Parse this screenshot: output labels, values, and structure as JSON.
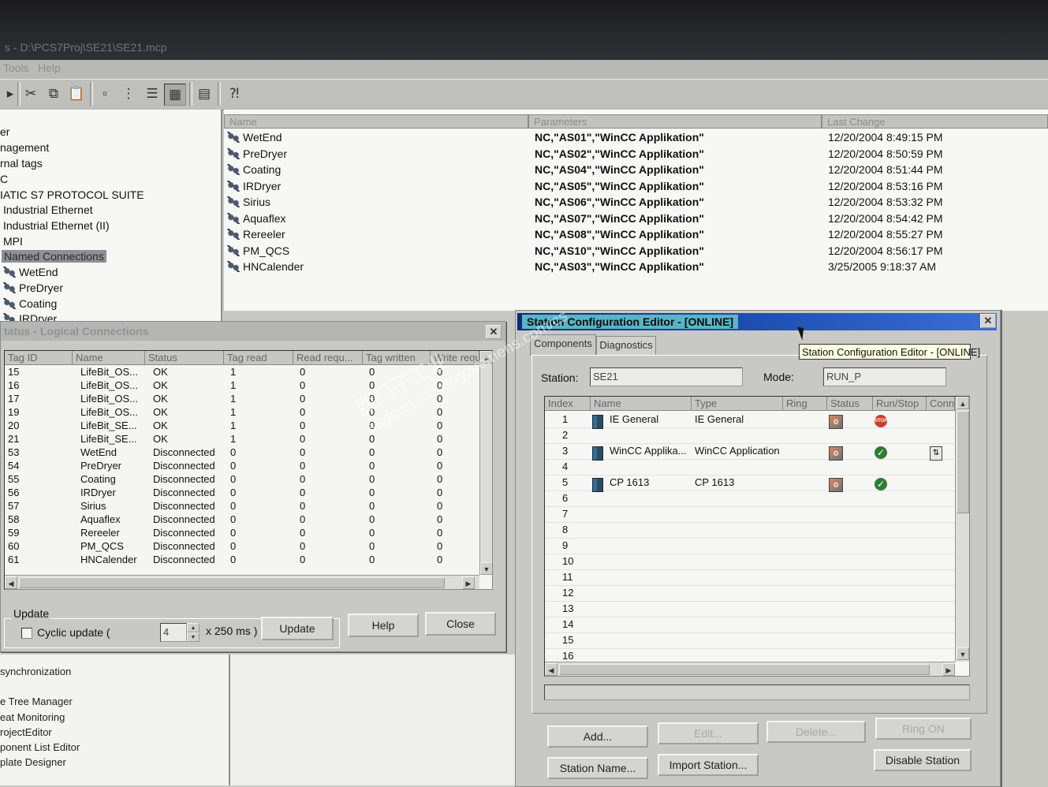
{
  "window": {
    "title": "s - D:\\PCS7Proj\\SE21\\SE21.mcp"
  },
  "menu": [
    "Tools",
    "Help"
  ],
  "toolbar_icons": [
    "back-icon",
    "cut-icon",
    "copy-icon",
    "paste-icon",
    "large-icons-icon",
    "small-icons-icon",
    "list-icon",
    "details-icon",
    "properties-icon",
    "help-icon"
  ],
  "tree": {
    "items": [
      "er",
      "nagement",
      "rnal tags",
      "C",
      "IATIC S7 PROTOCOL SUITE",
      "Industrial Ethernet",
      "Industrial Ethernet (II)",
      "MPI",
      "Named Connections",
      "WetEnd",
      "PreDryer",
      "Coating",
      "IRDryer"
    ],
    "selected": "Named Connections"
  },
  "list": {
    "columns": [
      "Name",
      "Parameters",
      "Last Change"
    ],
    "rows": [
      [
        "WetEnd",
        "NC,\"AS01\",\"WinCC Applikation\"",
        "12/20/2004 8:49:15 PM"
      ],
      [
        "PreDryer",
        "NC,\"AS02\",\"WinCC Applikation\"",
        "12/20/2004 8:50:59 PM"
      ],
      [
        "Coating",
        "NC,\"AS04\",\"WinCC Applikation\"",
        "12/20/2004 8:51:44 PM"
      ],
      [
        "IRDryer",
        "NC,\"AS05\",\"WinCC Applikation\"",
        "12/20/2004 8:53:16 PM"
      ],
      [
        "Sirius",
        "NC,\"AS06\",\"WinCC Applikation\"",
        "12/20/2004 8:53:32 PM"
      ],
      [
        "Aquaflex",
        "NC,\"AS07\",\"WinCC Applikation\"",
        "12/20/2004 8:54:42 PM"
      ],
      [
        "Rereeler",
        "NC,\"AS08\",\"WinCC Applikation\"",
        "12/20/2004 8:55:27 PM"
      ],
      [
        "PM_QCS",
        "NC,\"AS10\",\"WinCC Applikation\"",
        "12/20/2004 8:56:17 PM"
      ],
      [
        "HNCalender",
        "NC,\"AS03\",\"WinCC Applikation\"",
        "3/25/2005 9:18:37 AM"
      ]
    ]
  },
  "status_dialog": {
    "title": "tatus - Logical Connections",
    "columns": [
      "Tag ID",
      "Name",
      "Status",
      "Tag read",
      "Read requ...",
      "Tag written",
      "Write requ"
    ],
    "rows": [
      [
        "15",
        "LifeBit_OS...",
        "OK",
        "1",
        "0",
        "0",
        "0"
      ],
      [
        "16",
        "LifeBit_OS...",
        "OK",
        "1",
        "0",
        "0",
        "0"
      ],
      [
        "17",
        "LifeBit_OS...",
        "OK",
        "1",
        "0",
        "0",
        "0"
      ],
      [
        "19",
        "LifeBit_OS...",
        "OK",
        "1",
        "0",
        "0",
        "0"
      ],
      [
        "20",
        "LifeBit_SE...",
        "OK",
        "1",
        "0",
        "0",
        "0"
      ],
      [
        "21",
        "LifeBit_SE...",
        "OK",
        "1",
        "0",
        "0",
        "0"
      ],
      [
        "53",
        "WetEnd",
        "Disconnected",
        "0",
        "0",
        "0",
        "0"
      ],
      [
        "54",
        "PreDryer",
        "Disconnected",
        "0",
        "0",
        "0",
        "0"
      ],
      [
        "55",
        "Coating",
        "Disconnected",
        "0",
        "0",
        "0",
        "0"
      ],
      [
        "56",
        "IRDryer",
        "Disconnected",
        "0",
        "0",
        "0",
        "0"
      ],
      [
        "57",
        "Sirius",
        "Disconnected",
        "0",
        "0",
        "0",
        "0"
      ],
      [
        "58",
        "Aquaflex",
        "Disconnected",
        "0",
        "0",
        "0",
        "0"
      ],
      [
        "59",
        "Rereeler",
        "Disconnected",
        "0",
        "0",
        "0",
        "0"
      ],
      [
        "60",
        "PM_QCS",
        "Disconnected",
        "0",
        "0",
        "0",
        "0"
      ],
      [
        "61",
        "HNCalender",
        "Disconnected",
        "0",
        "0",
        "0",
        "0"
      ]
    ],
    "update_group": "Update",
    "cyclic_label": "Cyclic update (",
    "cyclic_value": "4",
    "cyclic_unit": "x 250 ms )",
    "update_button": "Update",
    "help_button": "Help",
    "close_button": "Close"
  },
  "lower_tree": [
    "synchronization",
    "e Tree Manager",
    "eat Monitoring",
    "rojectEditor",
    "ponent List Editor",
    "plate Designer"
  ],
  "station_dialog": {
    "title": "Station Configuration Editor - [ONLINE]",
    "tabs": [
      "Components",
      "Diagnostics"
    ],
    "station_label": "Station:",
    "station_value": "SE21",
    "mode_label": "Mode:",
    "mode_value": "RUN_P",
    "columns": [
      "Index",
      "Name",
      "Type",
      "Ring",
      "Status",
      "Run/Stop",
      "Conn"
    ],
    "rows": [
      {
        "index": "1",
        "name": "IE General",
        "type": "IE General",
        "status": true,
        "run": "stop",
        "conn": false
      },
      {
        "index": "2",
        "name": "",
        "type": "",
        "status": false,
        "run": "",
        "conn": false
      },
      {
        "index": "3",
        "name": "WinCC Applika...",
        "type": "WinCC Application",
        "status": true,
        "run": "ok",
        "conn": true
      },
      {
        "index": "4",
        "name": "",
        "type": "",
        "status": false,
        "run": "",
        "conn": false
      },
      {
        "index": "5",
        "name": "CP 1613",
        "type": "CP 1613",
        "status": true,
        "run": "ok",
        "conn": false
      },
      {
        "index": "6",
        "name": "",
        "type": "",
        "status": false,
        "run": "",
        "conn": false
      },
      {
        "index": "7",
        "name": "",
        "type": "",
        "status": false,
        "run": "",
        "conn": false
      },
      {
        "index": "8",
        "name": "",
        "type": "",
        "status": false,
        "run": "",
        "conn": false
      },
      {
        "index": "9",
        "name": "",
        "type": "",
        "status": false,
        "run": "",
        "conn": false
      },
      {
        "index": "10",
        "name": "",
        "type": "",
        "status": false,
        "run": "",
        "conn": false
      },
      {
        "index": "11",
        "name": "",
        "type": "",
        "status": false,
        "run": "",
        "conn": false
      },
      {
        "index": "12",
        "name": "",
        "type": "",
        "status": false,
        "run": "",
        "conn": false
      },
      {
        "index": "13",
        "name": "",
        "type": "",
        "status": false,
        "run": "",
        "conn": false
      },
      {
        "index": "14",
        "name": "",
        "type": "",
        "status": false,
        "run": "",
        "conn": false
      },
      {
        "index": "15",
        "name": "",
        "type": "",
        "status": false,
        "run": "",
        "conn": false
      },
      {
        "index": "16",
        "name": "",
        "type": "",
        "status": false,
        "run": "",
        "conn": false
      }
    ],
    "stop_text": "STOP",
    "buttons": {
      "add": "Add...",
      "edit": "Edit...",
      "delete": "Delete...",
      "ring_on": "Ring ON",
      "station_name": "Station Name...",
      "import_station": "Import Station...",
      "disable_station": "Disable Station"
    },
    "tooltip": "Station Configuration Editor - [ONLINE]"
  },
  "watermark": [
    "西门子工业",
    "support.industry.siemens.com/cs"
  ]
}
